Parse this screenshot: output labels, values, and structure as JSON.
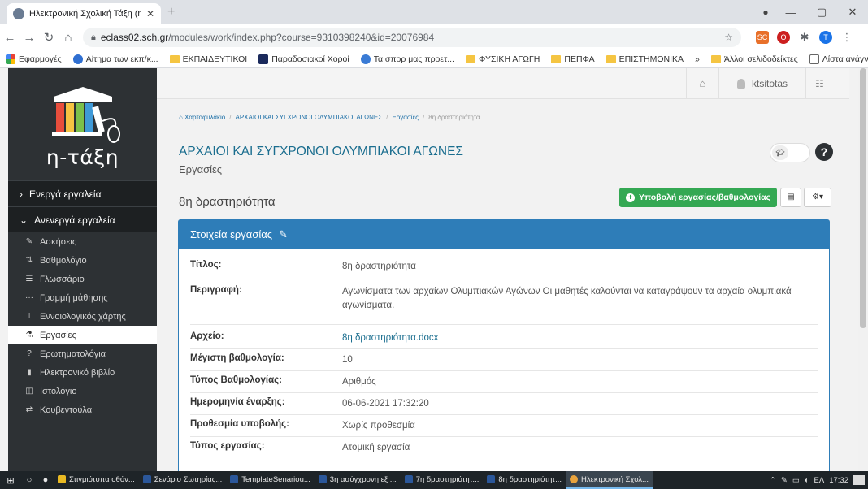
{
  "browser": {
    "tab_title": "Ηλεκτρονική Σχολική Τάξη (η-Τά",
    "tab_close": "✕",
    "new_tab": "+",
    "url_host": "eclass02.sch.gr",
    "url_path": "/modules/work/index.php?course=9310398240&id=20076984",
    "profile_initial": "T",
    "ext_label": "SC",
    "bookmarks": [
      "Εφαρμογές",
      "Αίτημα των εκπ/κ...",
      "ΕΚΠΑΙΔΕΥΤΙΚΟΙ",
      "Παραδοσιακοί Χοροί",
      "Τα σπορ μας προετ...",
      "ΦΥΣΙΚΗ ΑΓΩΓΗ",
      "ΠΕΠΦΑ",
      "ΕΠΙΣΤΗΜΟΝΙΚΑ"
    ],
    "bookmarks_more": "»",
    "other_bookmarks": "Άλλοι σελιδοδείκτες",
    "reading_list": "Λίστα ανάγνωσης"
  },
  "sidebar": {
    "brand": "η-τάξη",
    "active_tools": "Ενεργά εργαλεία",
    "inactive_tools": "Ανενεργά εργαλεία",
    "items": [
      {
        "label": "Ασκήσεις",
        "icon": "edit-icon"
      },
      {
        "label": "Βαθμολόγιο",
        "icon": "sort-icon"
      },
      {
        "label": "Γλωσσάριο",
        "icon": "list-icon"
      },
      {
        "label": "Γραμμή μάθησης",
        "icon": "ellipsis-icon"
      },
      {
        "label": "Εννοιολογικός χάρτης",
        "icon": "sitemap-icon"
      },
      {
        "label": "Εργασίες",
        "icon": "flask-icon"
      },
      {
        "label": "Ερωτηματολόγια",
        "icon": "question-icon"
      },
      {
        "label": "Ηλεκτρονικό βιβλίο",
        "icon": "book-icon"
      },
      {
        "label": "Ιστολόγιο",
        "icon": "columns-icon"
      },
      {
        "label": "Κουβεντούλα",
        "icon": "exchange-icon"
      }
    ]
  },
  "topbar": {
    "username": "ktsitotas"
  },
  "breadcrumb": {
    "home": "Χαρτοφυλάκιο",
    "course": "ΑΡΧΑΙΟΙ ΚΑΙ ΣΥΓΧΡΟΝΟΙ ΟΛΥΜΠΙΑΚΟΙ ΑΓΩΝΕΣ",
    "module": "Εργασίες",
    "current": "8η δραστηριότητα"
  },
  "course": {
    "title": "ΑΡΧΑΙΟΙ ΚΑΙ ΣΥΓΧΡΟΝΟΙ ΟΛΥΜΠΙΑΚΟΙ ΑΓΩΝΕΣ",
    "subtitle": "Εργασίες"
  },
  "assignment": {
    "title": "8η δραστηριότητα",
    "submit_button": "Υποβολή εργασίας/βαθμολογίας",
    "panel_title": "Στοιχεία εργασίας",
    "rows": [
      {
        "label": "Τίτλος:",
        "value": "8η δραστηριότητα"
      },
      {
        "label": "Περιγραφή:",
        "value": "Αγωνίσματα των αρχαίων Ολυμπιακών Αγώνων Οι μαθητές καλούνται να καταγράψουν τα αρχαία ολυμπιακά αγωνίσματα."
      },
      {
        "label": "Αρχείο:",
        "value": "8η δραστηριότητα.docx"
      },
      {
        "label": "Μέγιστη βαθμολογία:",
        "value": "10"
      },
      {
        "label": "Τύπος Βαθμολογίας:",
        "value": "Αριθμός"
      },
      {
        "label": "Ημερομηνία έναρξης:",
        "value": "06-06-2021 17:32:20"
      },
      {
        "label": "Προθεσμία υποβολής:",
        "value": "Χωρίς προθεσμία"
      },
      {
        "label": "Τύπος εργασίας:",
        "value": "Ατομική εργασία"
      }
    ]
  },
  "taskbar": {
    "apps": [
      {
        "label": "Στιγμιότυπα οθόν...",
        "color": "#e8b923"
      },
      {
        "label": "Σενάριο Σωτηρίας...",
        "color": "#2b579a"
      },
      {
        "label": "TemplateSenariou...",
        "color": "#2b579a"
      },
      {
        "label": "3η ασύγχρονη εξ ...",
        "color": "#2b579a"
      },
      {
        "label": "7η δραστηριότητ...",
        "color": "#2b579a"
      },
      {
        "label": "8η δραστηριότητ...",
        "color": "#2b579a"
      },
      {
        "label": "Ηλεκτρονική Σχολ...",
        "color": "#e8a33d"
      }
    ],
    "language": "ΕΛ",
    "clock": "17:32"
  },
  "colors": {
    "accent_blue": "#2e7db8",
    "submit_green": "#34a853",
    "sidebar_dark": "#2d3134",
    "link_teal": "#1b6e8f"
  }
}
